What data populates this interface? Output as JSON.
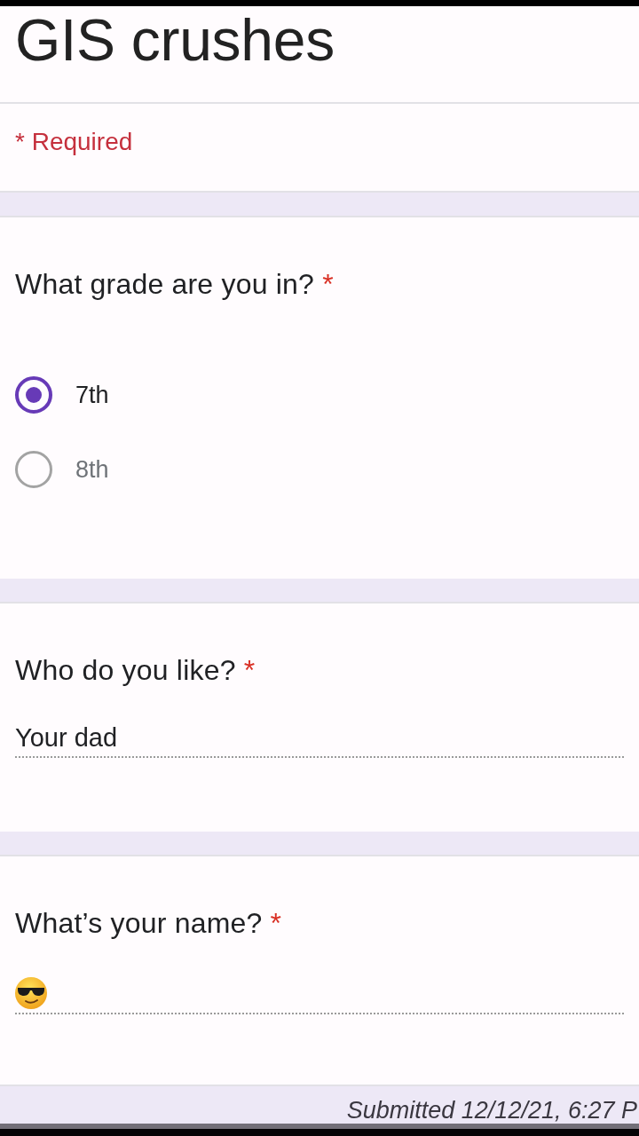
{
  "form": {
    "title": "GIS crushes",
    "required_note": "* Required"
  },
  "questions": [
    {
      "kind": "choice",
      "title": "What grade are you in?",
      "required_mark": "*",
      "options": [
        {
          "label": "7th",
          "selected": true
        },
        {
          "label": "8th",
          "selected": false
        }
      ]
    },
    {
      "kind": "text",
      "title": "Who do you like?",
      "required_mark": "*",
      "answer": {
        "kind": "text",
        "value": "Your dad"
      }
    },
    {
      "kind": "text",
      "title": "What’s your name?",
      "required_mark": "*",
      "answer": {
        "kind": "emoji"
      }
    }
  ],
  "footer": {
    "caption": "Submitted 12/12/21, 6:27 P"
  }
}
